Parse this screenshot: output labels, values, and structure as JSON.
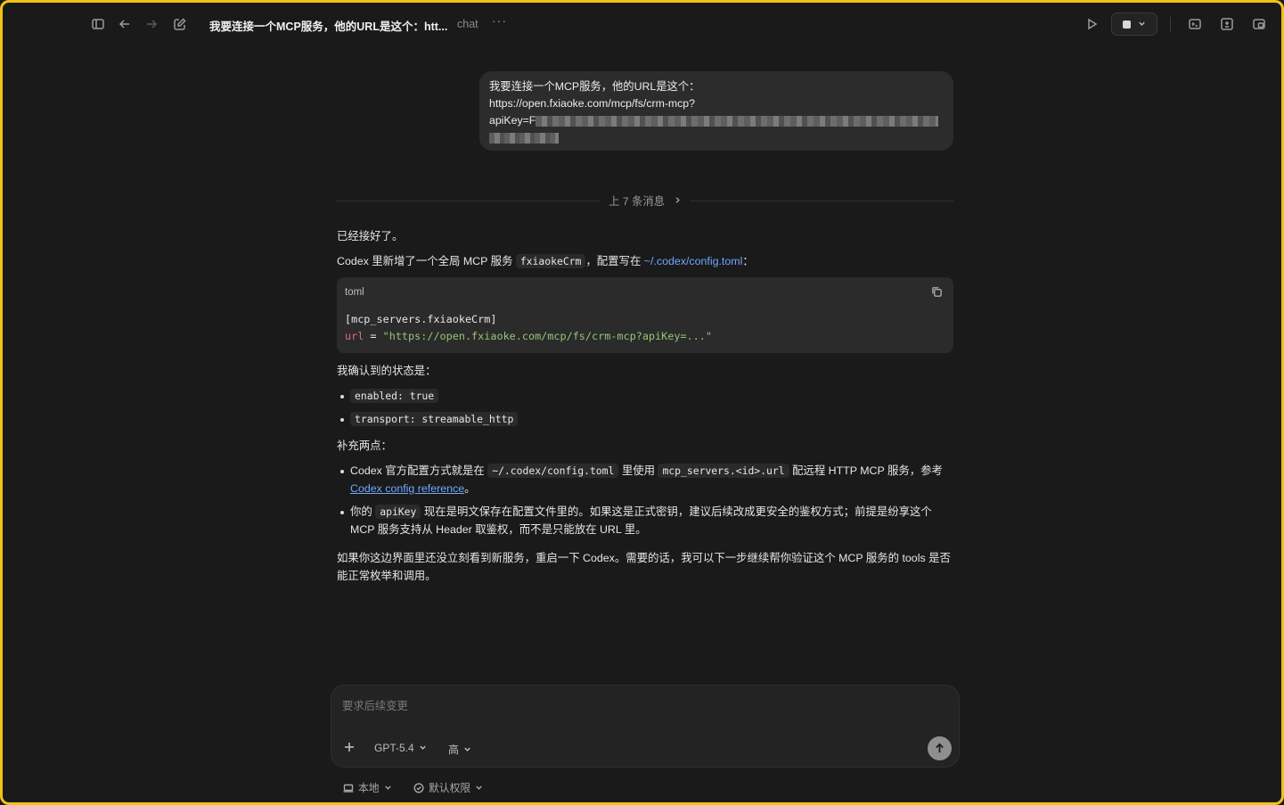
{
  "window": {
    "title": "我要连接一个MCP服务，他的URL是这个：htt...",
    "subtitle": "chat",
    "more": "···"
  },
  "user_message": {
    "line1": "我要连接一个MCP服务，他的URL是这个：",
    "line2": "https://open.fxiaoke.com/mcp/fs/crm-mcp?",
    "line3_prefix": "apiKey=F"
  },
  "earlier": {
    "label": "上 7 条消息"
  },
  "assistant": {
    "p1": "已经接好了。",
    "p2_a": "Codex 里新增了一个全局 MCP 服务 ",
    "p2_code": "fxiaokeCrm",
    "p2_b": "，配置写在 ",
    "p2_link": "~/.codex/config.toml",
    "p2_c": "：",
    "codeblock": {
      "lang": "toml",
      "line1": "[mcp_servers.fxiaokeCrm]",
      "line2_key": "url",
      "line2_eq": " = ",
      "line2_val": "\"https://open.fxiaoke.com/mcp/fs/crm-mcp?apiKey=...\""
    },
    "p3": "我确认到的状态是：",
    "status": [
      "enabled: true",
      "transport: streamable_http"
    ],
    "p4": "补充两点：",
    "note1": {
      "a": "Codex 官方配置方式就是在 ",
      "code1": "~/.codex/config.toml",
      "b": " 里使用 ",
      "code2": "mcp_servers.<id>.url",
      "c": " 配远程 HTTP MCP 服务，参考 ",
      "link": "Codex config reference",
      "d": "。"
    },
    "note2": {
      "a": "你的 ",
      "code": "apiKey",
      "b": " 现在是明文保存在配置文件里的。如果这是正式密钥，建议后续改成更安全的鉴权方式；前提是纷享这个 MCP 服务支持从 Header 取鉴权，而不是只能放在 URL 里。"
    },
    "p5": "如果你这边界面里还没立刻看到新服务，重启一下 Codex。需要的话，我可以下一步继续帮你验证这个 MCP 服务的 tools 是否能正常枚举和调用。"
  },
  "composer": {
    "placeholder": "要求后续变更",
    "model": "GPT-5.4",
    "effort": "高"
  },
  "footer": {
    "env": "本地",
    "permission": "默认权限"
  }
}
